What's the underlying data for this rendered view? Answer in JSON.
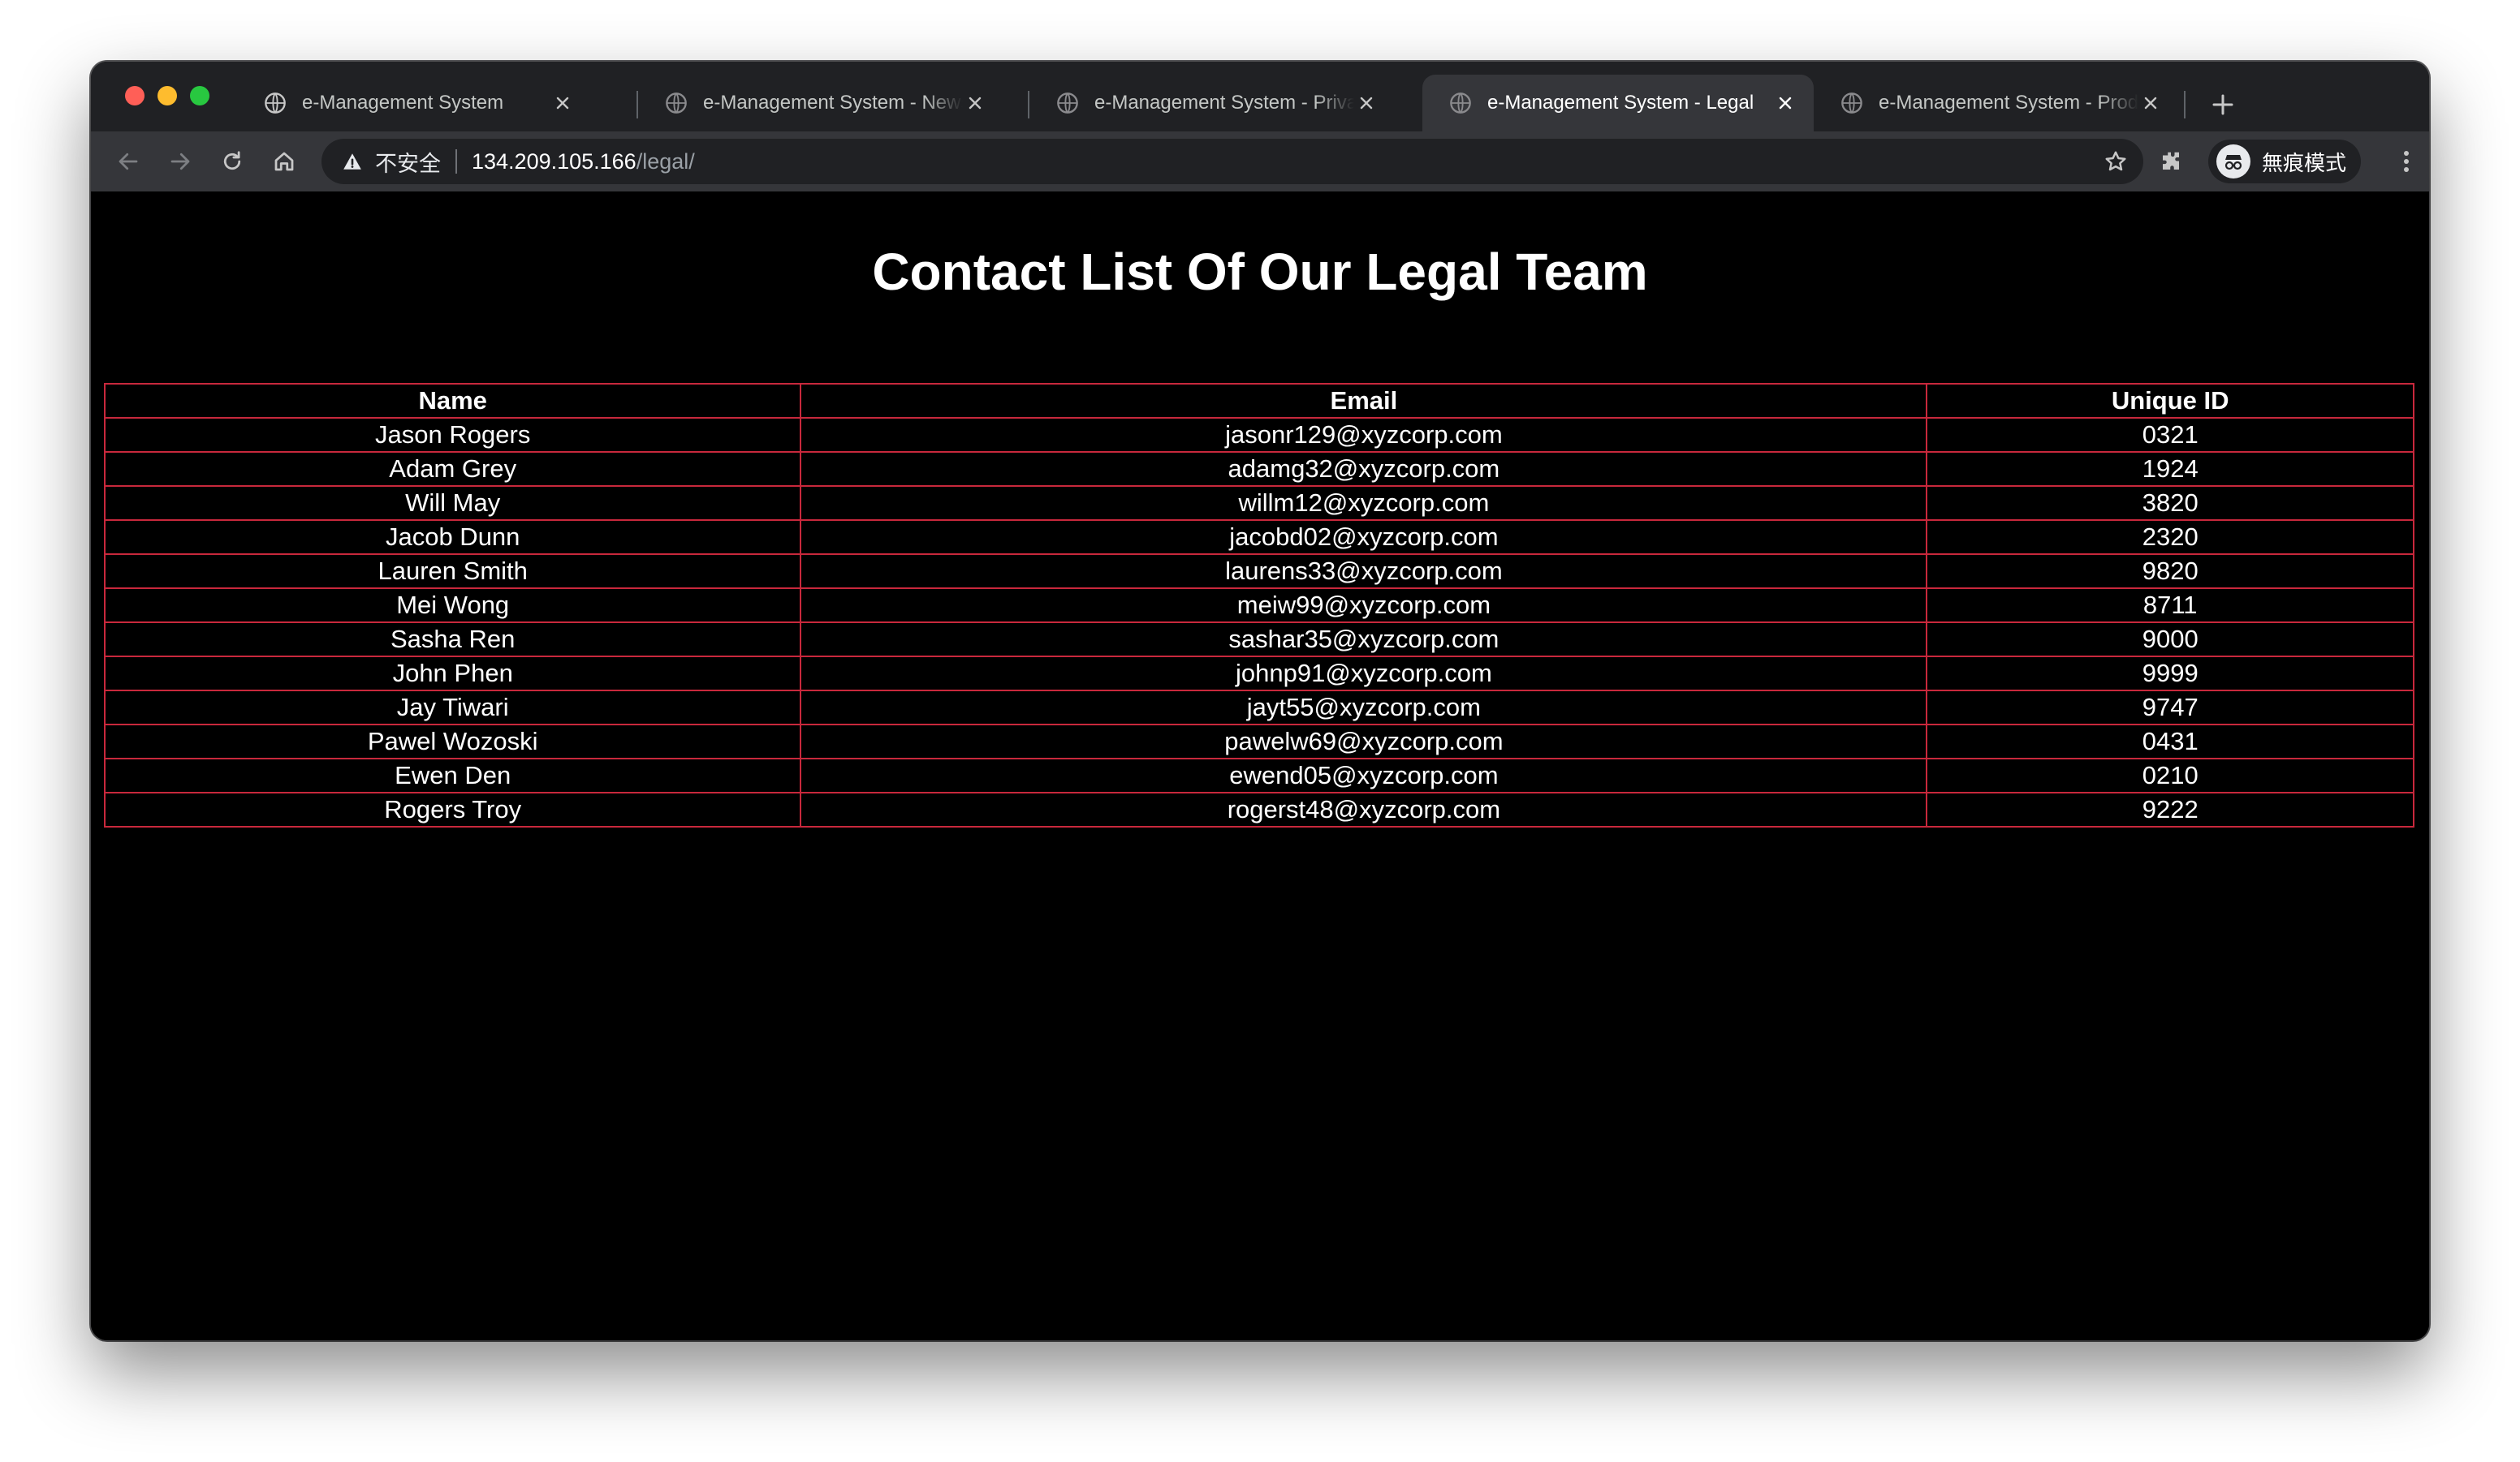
{
  "browser": {
    "tabs": [
      {
        "title": "e-Management System",
        "active": false
      },
      {
        "title": "e-Management System - Newsletter",
        "active": false
      },
      {
        "title": "e-Management System - Privacy",
        "active": false
      },
      {
        "title": "e-Management System - Legal",
        "active": true
      },
      {
        "title": "e-Management System - Products",
        "active": false
      }
    ],
    "omnibox": {
      "security_label": "不安全",
      "url_host": "134.209.105.166",
      "url_path": "/legal/"
    },
    "profile_label": "無痕模式"
  },
  "page": {
    "title": "Contact List Of Our Legal Team",
    "table": {
      "headers": [
        "Name",
        "Email",
        "Unique ID"
      ],
      "rows": [
        [
          "Jason Rogers",
          "jasonr129@xyzcorp.com",
          "0321"
        ],
        [
          "Adam Grey",
          "adamg32@xyzcorp.com",
          "1924"
        ],
        [
          "Will May",
          "willm12@xyzcorp.com",
          "3820"
        ],
        [
          "Jacob Dunn",
          "jacobd02@xyzcorp.com",
          "2320"
        ],
        [
          "Lauren Smith",
          "laurens33@xyzcorp.com",
          "9820"
        ],
        [
          "Mei Wong",
          "meiw99@xyzcorp.com",
          "8711"
        ],
        [
          "Sasha Ren",
          "sashar35@xyzcorp.com",
          "9000"
        ],
        [
          "John Phen",
          "johnp91@xyzcorp.com",
          "9999"
        ],
        [
          "Jay Tiwari",
          "jayt55@xyzcorp.com",
          "9747"
        ],
        [
          "Pawel Wozoski",
          "pawelw69@xyzcorp.com",
          "0431"
        ],
        [
          "Ewen Den",
          "ewend05@xyzcorp.com",
          "0210"
        ],
        [
          "Rogers Troy",
          "rogerst48@xyzcorp.com",
          "9222"
        ]
      ]
    }
  },
  "colors": {
    "table_border": "#c8283c",
    "page_background": "#000000",
    "tab_strip": "#202124",
    "toolbar": "#35363a"
  }
}
